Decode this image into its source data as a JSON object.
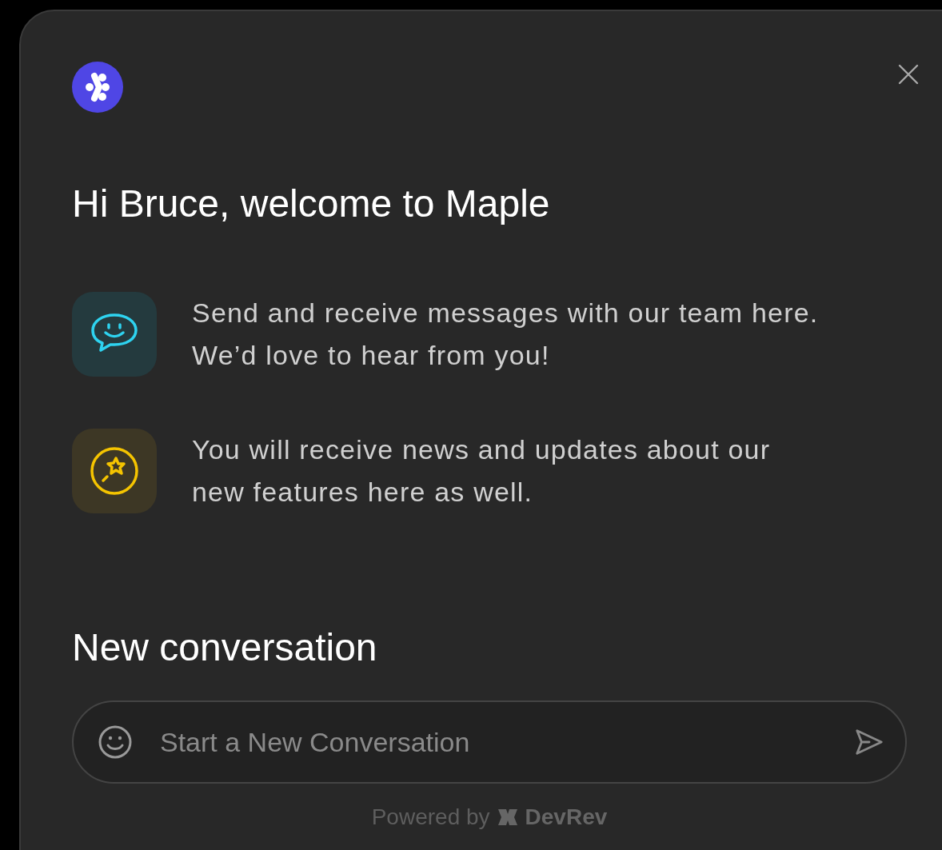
{
  "greeting": "Hi Bruce, welcome to Maple",
  "features": [
    {
      "kind": "chat",
      "text": "Send and receive messages with our team here. We’d love to hear from you!"
    },
    {
      "kind": "news",
      "text": "You will receive news and updates about our new features here as well."
    }
  ],
  "section_title": "New conversation",
  "composer": {
    "placeholder": "Start a New Conversation"
  },
  "footer": {
    "text": "Powered by",
    "brand": "DevRev"
  }
}
